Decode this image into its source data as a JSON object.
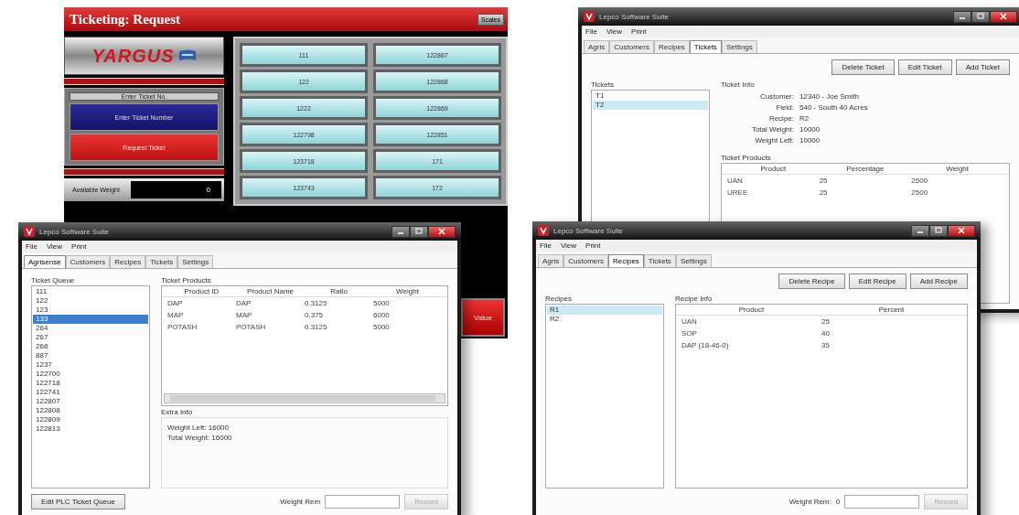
{
  "hmi": {
    "title": "Ticketing: Request",
    "corner_button": "Scales",
    "logo": "YARGUS",
    "entry_label": "Enter Ticket No.",
    "entry_button": "Enter Ticket Number",
    "request_button": "Request Ticket",
    "weight_label": "Available Weight",
    "weight_value": "0",
    "value_button": "Value",
    "tickets": [
      "111",
      "122867",
      "122",
      "122868",
      "1222",
      "122869",
      "122798",
      "122851",
      "123718",
      "171",
      "123743",
      "172"
    ]
  },
  "windows": [
    {
      "title": "Lepco Software Suite",
      "menu": [
        "File",
        "View",
        "Print"
      ],
      "tabs": [
        {
          "label": "Agris",
          "selected": false
        },
        {
          "label": "Customers",
          "selected": false
        },
        {
          "label": "Recipes",
          "selected": false
        },
        {
          "label": "Tickets",
          "selected": true
        },
        {
          "label": "Settings",
          "selected": false
        }
      ],
      "actions": [
        "Delete Ticket",
        "Edit Ticket",
        "Add Ticket"
      ],
      "list": {
        "title": "Tickets",
        "focused": false,
        "items": [
          {
            "label": "T1",
            "selected": false
          },
          {
            "label": "T2",
            "selected": true
          }
        ]
      },
      "info": {
        "title": "Ticket Info",
        "fields": [
          {
            "label": "Customer:",
            "value": "12340 - Joe Smith"
          },
          {
            "label": "Field:",
            "value": "540 - South 40 Acres"
          },
          {
            "label": "Recipe:",
            "value": "R2"
          },
          {
            "label": "Total Weight:",
            "value": "10000"
          },
          {
            "label": "Weight Left:",
            "value": "10000"
          }
        ]
      },
      "table": {
        "title": "Ticket Products",
        "columns": [
          "Product",
          "Percentage",
          "Weight"
        ],
        "rows": [
          [
            "UAN",
            "25",
            "2500"
          ],
          [
            "UREE",
            "25",
            "2500"
          ]
        ]
      }
    },
    {
      "title": "Lepco Software Suite",
      "menu": [
        "File",
        "View",
        "Print"
      ],
      "tabs": [
        {
          "label": "Agrisense",
          "selected": true
        },
        {
          "label": "Customers",
          "selected": false
        },
        {
          "label": "Recipes",
          "selected": false
        },
        {
          "label": "Tickets",
          "selected": false
        },
        {
          "label": "Settings",
          "selected": false
        }
      ],
      "list": {
        "title": "Ticket Queue",
        "focused": true,
        "items": [
          {
            "label": "111",
            "selected": false
          },
          {
            "label": "122",
            "selected": false
          },
          {
            "label": "123",
            "selected": false
          },
          {
            "label": "133",
            "selected": true
          },
          {
            "label": "264",
            "selected": false
          },
          {
            "label": "267",
            "selected": false
          },
          {
            "label": "268",
            "selected": false
          },
          {
            "label": "887",
            "selected": false
          },
          {
            "label": "1237",
            "selected": false
          },
          {
            "label": "122700",
            "selected": false
          },
          {
            "label": "122718",
            "selected": false
          },
          {
            "label": "122741",
            "selected": false
          },
          {
            "label": "122807",
            "selected": false
          },
          {
            "label": "122808",
            "selected": false
          },
          {
            "label": "122809",
            "selected": false
          },
          {
            "label": "122813",
            "selected": false
          }
        ]
      },
      "table": {
        "title": "Ticket Products",
        "columns": [
          "Product ID",
          "Product Name",
          "Ratio",
          "Weight"
        ],
        "rows": [
          [
            "DAP",
            "DAP",
            "0.3125",
            "5000"
          ],
          [
            "MAP",
            "MAP",
            "0.375",
            "6000"
          ],
          [
            "POTASH",
            "POTASH",
            "0.3125",
            "5000"
          ]
        ],
        "scrollbar": true
      },
      "extra": {
        "title": "Extra Info",
        "lines": [
          "Weight Left: 16000",
          "Total Weight: 16000"
        ]
      },
      "footer": {
        "button": "Edit PLC Ticket Queue",
        "label": "Weight Rem",
        "record": "Record",
        "record_disabled": true
      }
    },
    {
      "title": "Lepco Software Suite",
      "menu": [
        "File",
        "View",
        "Print"
      ],
      "tabs": [
        {
          "label": "Agris",
          "selected": false
        },
        {
          "label": "Customers",
          "selected": false
        },
        {
          "label": "Recipes",
          "selected": true
        },
        {
          "label": "Tickets",
          "selected": false
        },
        {
          "label": "Settings",
          "selected": false
        }
      ],
      "actions": [
        "Delete Recipe",
        "Edit Recipe",
        "Add Recipe"
      ],
      "list": {
        "title": "Recipes",
        "focused": false,
        "items": [
          {
            "label": "R1",
            "selected": true
          },
          {
            "label": "R2",
            "selected": false
          }
        ]
      },
      "table": {
        "title": "Recipe Info",
        "columns": [
          "Product",
          "Percent"
        ],
        "rows": [
          [
            "UAN",
            "25"
          ],
          [
            "SOP",
            "40"
          ],
          [
            "DAP (18-46-0)",
            "35"
          ]
        ]
      },
      "footer": {
        "label": "Weight Rem:",
        "value": "0",
        "record": "Record",
        "record_disabled": true
      }
    }
  ]
}
